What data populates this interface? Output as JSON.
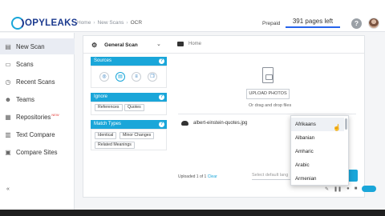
{
  "header": {
    "logo_text": "OPYLEAKS",
    "breadcrumb": [
      "Home",
      "New Scans",
      "OCR"
    ],
    "plan_label": "Prepaid",
    "pages_left": "391 pages left"
  },
  "sidebar": {
    "items": [
      {
        "label": "New Scan",
        "icon": "new-scan-icon",
        "active": true
      },
      {
        "label": "Scans",
        "icon": "scans-icon",
        "active": false
      },
      {
        "label": "Recent Scans",
        "icon": "clock-icon",
        "active": false
      },
      {
        "label": "Teams",
        "icon": "team-icon",
        "active": false
      },
      {
        "label": "Repositories",
        "icon": "repository-icon",
        "active": false,
        "badge": "NEW"
      },
      {
        "label": "Text Compare",
        "icon": "text-compare-icon",
        "active": false
      },
      {
        "label": "Compare Sites",
        "icon": "compare-sites-icon",
        "active": false
      }
    ],
    "collapse": "«"
  },
  "scan": {
    "type_label": "General Scan",
    "folder_label": "Home"
  },
  "sections": {
    "sources": "Sources",
    "ignore": "Ignore",
    "match_types": "Match Types"
  },
  "ignore_chips": [
    "References",
    "Quotes"
  ],
  "match_chips": [
    "Identical",
    "Minor Changes",
    "Related Meanings"
  ],
  "upload": {
    "button_label": "UPLOAD PHOTOS",
    "drop_text": "Or drag and drop files",
    "file_name": "albert-einstein-quotes.jpg",
    "uploaded_text": "Uploaded 1 of 1",
    "clear_label": "Clear",
    "language_placeholder": "Select default lang"
  },
  "language_dropdown": {
    "options": [
      "Afrikaans",
      "Albanian",
      "Amharic",
      "Arabic",
      "Armenian"
    ],
    "hovered": "Afrikaans"
  },
  "colors": {
    "accent": "#1aa6d9",
    "brand": "#1b3a8f",
    "active_nav_bg": "#e9ecf3"
  }
}
